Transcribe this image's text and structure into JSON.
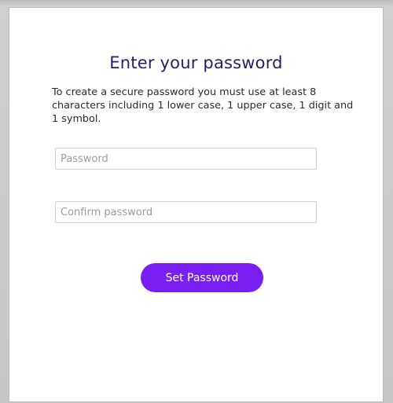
{
  "dialog": {
    "title": "Enter your password",
    "description": "To create a secure password you must use at least 8 characters including 1 lower case, 1 upper case, 1 digit and 1 symbol.",
    "password_placeholder": "Password",
    "password_value": "",
    "confirm_placeholder": "Confirm password",
    "confirm_value": "",
    "submit_label": "Set Password"
  },
  "colors": {
    "title": "#2b1a6b",
    "accent": "#7a1ff2",
    "backdrop": "#c9c9c9"
  }
}
